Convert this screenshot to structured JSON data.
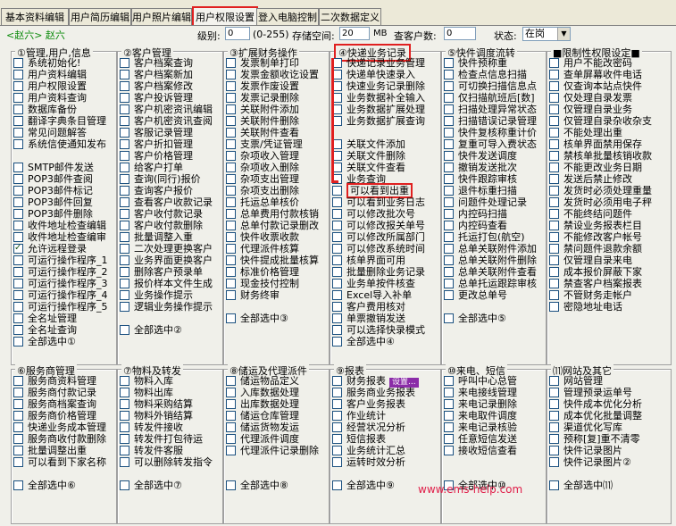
{
  "tabs": [
    {
      "label": "基本资料编辑",
      "w": 74
    },
    {
      "label": "用户简历编辑",
      "w": 68
    },
    {
      "label": "用户照片编辑",
      "w": 66
    },
    {
      "label": "用户权限设置",
      "w": 70,
      "active": true
    },
    {
      "label": "登入电脑控制",
      "w": 68
    },
    {
      "label": "二次数据定义",
      "w": 68
    }
  ],
  "toolbar": {
    "crumb": "<赵六> 赵六",
    "level_label": "级别:",
    "level_value": "0",
    "level_hint": "(0-255)",
    "storage_label": "存储空间:",
    "storage_value": "20",
    "storage_unit": "MB",
    "stations_label": "查客户数:",
    "stations_value": "0",
    "state_label": "状态:",
    "state_value": "在岗"
  },
  "groups": [
    {
      "title": "①管理,用户,信息",
      "items": [
        {
          "t": "系统初始化!"
        },
        {
          "t": "用户资料编辑"
        },
        {
          "t": "用户权限设置"
        },
        {
          "t": "用户资料查询"
        },
        {
          "t": "数据库备份"
        },
        {
          "t": "翻译字典条目管理"
        },
        {
          "t": "常见问题解答"
        },
        {
          "t": "系统信使通知发布"
        },
        {
          "t": ""
        },
        {
          "t": "SMTP邮件发送"
        },
        {
          "t": "POP3邮件查阅"
        },
        {
          "t": "POP3邮件标记"
        },
        {
          "t": "POP3邮件回复"
        },
        {
          "t": "POP3邮件删除"
        },
        {
          "t": "收件地址检查编辑"
        },
        {
          "t": "收件地址检查编审"
        },
        {
          "t": "允许远程登录",
          "on": true
        },
        {
          "t": "可运行操作程序_1"
        },
        {
          "t": "可运行操作程序_2"
        },
        {
          "t": "可运行操作程序_3"
        },
        {
          "t": "可运行操作程序_4"
        },
        {
          "t": "可运行操作程序_5"
        },
        {
          "t": "全名址管理"
        },
        {
          "t": "全名址查询"
        },
        {
          "t": "全部选中①"
        }
      ]
    },
    {
      "title": "②客户管理",
      "items": [
        {
          "t": "客户档案查询"
        },
        {
          "t": "客户档案新加"
        },
        {
          "t": "客户档案修改"
        },
        {
          "t": "客户投诉管理"
        },
        {
          "t": "客户机密资讯编辑"
        },
        {
          "t": "客户机密资讯查阅"
        },
        {
          "t": "客服记录管理"
        },
        {
          "t": "客户折扣管理"
        },
        {
          "t": "客户价格管理"
        },
        {
          "t": "给客户打单"
        },
        {
          "t": "查询(同行)报价"
        },
        {
          "t": "查询客户报价"
        },
        {
          "t": "查看客户收款记录"
        },
        {
          "t": "客户收付款记录"
        },
        {
          "t": "客户收付款删除"
        },
        {
          "t": "批量调整入重"
        },
        {
          "t": "二次处理更换客户"
        },
        {
          "t": "业务界面更换客户"
        },
        {
          "t": "删除客户预录单"
        },
        {
          "t": "报价样本文件生成"
        },
        {
          "t": "业务操作提示"
        },
        {
          "t": "逻辑业务操作提示"
        },
        {
          "t": ""
        },
        {
          "t": "全部选中②"
        }
      ]
    },
    {
      "title": "③扩展财务操作",
      "items": [
        {
          "t": "发票制单打印"
        },
        {
          "t": "发票金额收讫设置"
        },
        {
          "t": "发票作废设置"
        },
        {
          "t": "发票记录删除"
        },
        {
          "t": "关联附件添加"
        },
        {
          "t": "关联附件删除"
        },
        {
          "t": "关联附件查看"
        },
        {
          "t": "支票/凭证管理"
        },
        {
          "t": "杂项收入管理"
        },
        {
          "t": "杂项收入删除"
        },
        {
          "t": "杂项支出管理"
        },
        {
          "t": "杂项支出删除"
        },
        {
          "t": "托运总单核价"
        },
        {
          "t": "总单费用付款核销"
        },
        {
          "t": "总单付款记录删改"
        },
        {
          "t": "快件收票收款"
        },
        {
          "t": "代理派件核算"
        },
        {
          "t": "快件提成批量核算"
        },
        {
          "t": "标准价格管理"
        },
        {
          "t": "现金技付控制"
        },
        {
          "t": "财务终审"
        },
        {
          "t": ""
        },
        {
          "t": "全部选中③"
        }
      ]
    },
    {
      "title": "④快递业务记录",
      "hl": true,
      "items": [
        {
          "t": "快递记录业务管理"
        },
        {
          "t": "快递单快速录入"
        },
        {
          "t": "快速业务记录删除"
        },
        {
          "t": "业务数据补全输入"
        },
        {
          "t": "业务数据扩展处理"
        },
        {
          "t": "业务数据扩展查询"
        },
        {
          "t": ""
        },
        {
          "t": "关联文件添加"
        },
        {
          "t": "关联文件删除"
        },
        {
          "t": "关联文件查看"
        },
        {
          "t": "业务查询"
        },
        {
          "t": "可以看到出重",
          "box": true
        },
        {
          "t": "可以看到业务日志"
        },
        {
          "t": "可以修改批次号"
        },
        {
          "t": "可以修改报关单号"
        },
        {
          "t": "可以修改所属部门"
        },
        {
          "t": "可以修改系统时间"
        },
        {
          "t": "核单界面可用"
        },
        {
          "t": "批量删除业务记录"
        },
        {
          "t": "业务单按件核查"
        },
        {
          "t": "Excel导入补单"
        },
        {
          "t": "客户费用核对"
        },
        {
          "t": "单票撤销发送"
        },
        {
          "t": "可以选择快录模式"
        },
        {
          "t": "全部选中④"
        }
      ]
    },
    {
      "title": "⑤快件调度流转",
      "items": [
        {
          "t": "快件预称重"
        },
        {
          "t": "检查点信息扫描"
        },
        {
          "t": "可切换扫描信息点"
        },
        {
          "t": "仅扫描航班后[数]"
        },
        {
          "t": "扫描处理异常状态"
        },
        {
          "t": "扫描错误记录管理"
        },
        {
          "t": "快件复核称重计价"
        },
        {
          "t": "复重可导入费状态"
        },
        {
          "t": "快件发送调度"
        },
        {
          "t": "撤销发送批次"
        },
        {
          "t": "快件跟踪审核"
        },
        {
          "t": "退件标重扫描"
        },
        {
          "t": "问题件处理记录"
        },
        {
          "t": "内控码扫描"
        },
        {
          "t": "内控码查看"
        },
        {
          "t": "托运打包(航空)"
        },
        {
          "t": "总单关联附件添加"
        },
        {
          "t": "总单关联附件删除"
        },
        {
          "t": "总单关联附件查看"
        },
        {
          "t": "总单托运跟踪审核"
        },
        {
          "t": "更改总单号"
        },
        {
          "t": ""
        },
        {
          "t": "全部选中⑤"
        }
      ]
    },
    {
      "title": "■限制性权限设定■",
      "items": [
        {
          "t": "用户不能改密码"
        },
        {
          "t": "查单屏幕收件电话"
        },
        {
          "t": "仅查询本站点快件"
        },
        {
          "t": "仅处理自录发票"
        },
        {
          "t": "仅管理自录业务"
        },
        {
          "t": "仅管理自录杂收杂支"
        },
        {
          "t": "不能处理出重"
        },
        {
          "t": "核单界面禁用保存"
        },
        {
          "t": "禁核单批量核销收款"
        },
        {
          "t": "不能更改业务日期"
        },
        {
          "t": "发送后禁止修改"
        },
        {
          "t": "发货时必须处理重量"
        },
        {
          "t": "发货时必须用电子秤"
        },
        {
          "t": "不能终结问题件"
        },
        {
          "t": "禁设业务报表栏目"
        },
        {
          "t": "不能修改客户帐号"
        },
        {
          "t": "禁问题件退款余额"
        },
        {
          "t": "仅管理自录来电"
        },
        {
          "t": "成本报价屏蔽下家"
        },
        {
          "t": "禁查客户档案报表"
        },
        {
          "t": "不管财务走帐户"
        },
        {
          "t": "密隐地址电话"
        }
      ]
    },
    {
      "title": "⑥服务商管理",
      "items": [
        {
          "t": "服务商资料管理"
        },
        {
          "t": "服务商付款记录"
        },
        {
          "t": "服务商档案查询"
        },
        {
          "t": "服务商价格管理"
        },
        {
          "t": "快递业务成本管理"
        },
        {
          "t": "服务商收付款删除"
        },
        {
          "t": "批量调整出重"
        },
        {
          "t": "可以看到下家名称"
        },
        {
          "t": ""
        },
        {
          "t": "全部选中⑥"
        }
      ]
    },
    {
      "title": "⑦物料及转发",
      "items": [
        {
          "t": "物料入库"
        },
        {
          "t": "物料出库"
        },
        {
          "t": "物料采购结算"
        },
        {
          "t": "物料外销结算"
        },
        {
          "t": "转发件接收"
        },
        {
          "t": "转发件打包待运"
        },
        {
          "t": "转发件客服"
        },
        {
          "t": "可以删除转发指令"
        },
        {
          "t": ""
        },
        {
          "t": "全部选中⑦"
        }
      ]
    },
    {
      "title": "⑧储运及代理派件",
      "items": [
        {
          "t": "储运物品定义"
        },
        {
          "t": "入库数据处理"
        },
        {
          "t": "出库数据处理"
        },
        {
          "t": "储运仓库管理"
        },
        {
          "t": "储运货物发运"
        },
        {
          "t": "代理派件调度"
        },
        {
          "t": "代理派件记录删除"
        },
        {
          "t": ""
        },
        {
          "t": ""
        },
        {
          "t": "全部选中⑧"
        }
      ]
    },
    {
      "title": "⑨报表",
      "items": [
        {
          "t": "财务报表",
          "badge": "设置..."
        },
        {
          "t": "服务商业务报表"
        },
        {
          "t": "客户业务报表"
        },
        {
          "t": "作业统计"
        },
        {
          "t": "经营状况分析"
        },
        {
          "t": "短信报表"
        },
        {
          "t": "业务统计汇总"
        },
        {
          "t": "运转时效分析"
        },
        {
          "t": ""
        },
        {
          "t": "全部选中⑨"
        }
      ]
    },
    {
      "title": "⑩来电、短信",
      "items": [
        {
          "t": "呼叫中心总管"
        },
        {
          "t": "来电接线管理"
        },
        {
          "t": "来电记录删除"
        },
        {
          "t": "来电取件调度"
        },
        {
          "t": "来电记录核验"
        },
        {
          "t": "任意短信发送"
        },
        {
          "t": "接收短信查看"
        },
        {
          "t": ""
        },
        {
          "t": ""
        },
        {
          "t": "全部选中⑩"
        }
      ]
    },
    {
      "title": "⑾网站及其它",
      "items": [
        {
          "t": "网站管理"
        },
        {
          "t": "管理预录运单号"
        },
        {
          "t": "快件成本优化分析"
        },
        {
          "t": "成本优化批量调整"
        },
        {
          "t": "渠道优化写库"
        },
        {
          "t": "预称[复]重不清零"
        },
        {
          "t": "快件记录图片"
        },
        {
          "t": "快件记录图片②"
        },
        {
          "t": ""
        },
        {
          "t": "全部选中⑾"
        }
      ]
    }
  ],
  "watermark": "www.ems-help.com"
}
